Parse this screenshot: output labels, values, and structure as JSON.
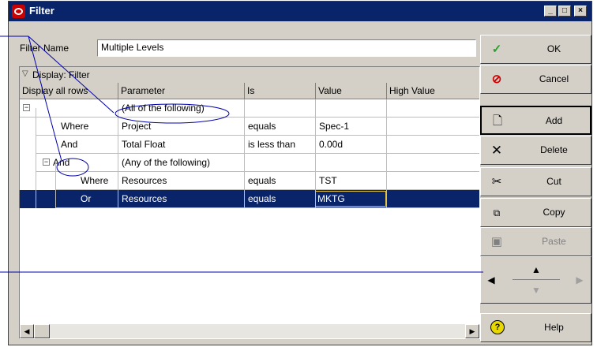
{
  "window": {
    "title": "Filter"
  },
  "filter_name": {
    "label": "Filter Name",
    "value": "Multiple Levels"
  },
  "grid": {
    "group_header": "Display: Filter",
    "columns": [
      "Display all rows",
      "Parameter",
      "Is",
      "Value",
      "High Value"
    ],
    "rows": [
      {
        "connector": "",
        "parameter": "(All of the following)",
        "is": "",
        "value": ""
      },
      {
        "connector": "Where",
        "parameter": "Project",
        "is": "equals",
        "value": "Spec-1"
      },
      {
        "connector": "And",
        "parameter": "Total Float",
        "is": "is less than",
        "value": "0.00d"
      },
      {
        "connector": "And",
        "parameter": "(Any of the following)",
        "is": "",
        "value": ""
      },
      {
        "connector": "Where",
        "parameter": "Resources",
        "is": "equals",
        "value": "TST"
      },
      {
        "connector": "Or",
        "parameter": "Resources",
        "is": "equals",
        "value": "MKTG"
      }
    ]
  },
  "buttons": {
    "ok": "OK",
    "cancel": "Cancel",
    "add": "Add",
    "delete": "Delete",
    "cut": "Cut",
    "copy": "Copy",
    "paste": "Paste",
    "help": "Help"
  },
  "icons": {
    "ok": "checkmark-icon",
    "cancel": "no-entry-icon",
    "add": "new-document-icon",
    "delete": "x-icon",
    "cut": "scissors-icon",
    "copy": "copy-icon",
    "paste": "paste-icon",
    "help": "question-icon"
  },
  "colors": {
    "title_bar": "#0a246a",
    "selection": "#0a246a",
    "annotation": "#0000aa",
    "ok_check": "#2e9e2e",
    "cancel_red": "#cc0000"
  }
}
